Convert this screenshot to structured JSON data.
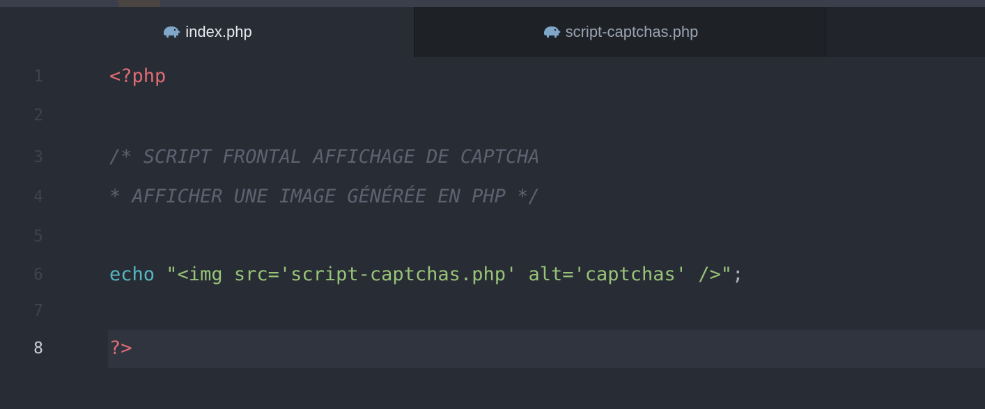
{
  "tabs": [
    {
      "label": "index.php",
      "icon": "php-elephant-icon",
      "active": true
    },
    {
      "label": "script-captchas.php",
      "icon": "php-elephant-icon",
      "active": false
    }
  ],
  "editor": {
    "current_line": 8,
    "lines": [
      {
        "number": "1",
        "text": "<?php"
      },
      {
        "number": "2",
        "text": ""
      },
      {
        "number": "3",
        "text": "/* SCRIPT FRONTAL AFFICHAGE DE CAPTCHA"
      },
      {
        "number": "4",
        "text": "* AFFICHER UNE IMAGE GÉNÉRÉE EN PHP */"
      },
      {
        "number": "5",
        "text": ""
      },
      {
        "number": "6",
        "keyword": "echo",
        "string": "\"<img src='script-captchas.php' alt='captchas' />\"",
        "punct": ";"
      },
      {
        "number": "7",
        "text": ""
      },
      {
        "number": "8",
        "text": "?>"
      }
    ]
  },
  "colors": {
    "background": "#282c34",
    "tag": "#e06c75",
    "comment": "#5c6370",
    "keyword": "#56b6c2",
    "string": "#98c379",
    "icon": "#7fa7c9"
  }
}
